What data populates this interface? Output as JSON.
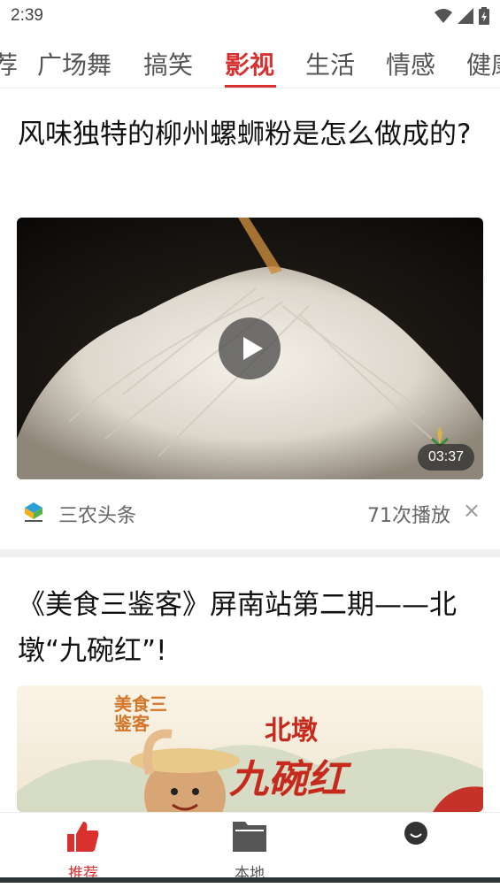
{
  "status_bar": {
    "time": "2:39"
  },
  "tabs": [
    {
      "label": "荐"
    },
    {
      "label": "广场舞"
    },
    {
      "label": "搞笑"
    },
    {
      "label": "影视"
    },
    {
      "label": "生活"
    },
    {
      "label": "情感"
    },
    {
      "label": "健康"
    }
  ],
  "active_tab": "影视",
  "articles": [
    {
      "title": "风味独特的柳州螺蛳粉是怎么做成的?",
      "duration": "03:37",
      "source": "三农头条",
      "plays": "71次播放",
      "dismiss": "×"
    },
    {
      "title": "《美食三鉴客》屏南站第二期——北墩“九碗红”!",
      "thumb_text_1": "北墩",
      "thumb_text_2": "九碗红",
      "thumb_text_3": "美食三鉴客"
    }
  ],
  "bottom_nav": [
    {
      "label": "推荐",
      "icon": "thumbs-up-icon",
      "active": true
    },
    {
      "label": "本地",
      "icon": "folder-icon",
      "active": false
    },
    {
      "label": "",
      "icon": "smile-icon",
      "active": false
    }
  ],
  "colors": {
    "accent": "#d93030",
    "text": "#111111",
    "muted": "#666666"
  }
}
